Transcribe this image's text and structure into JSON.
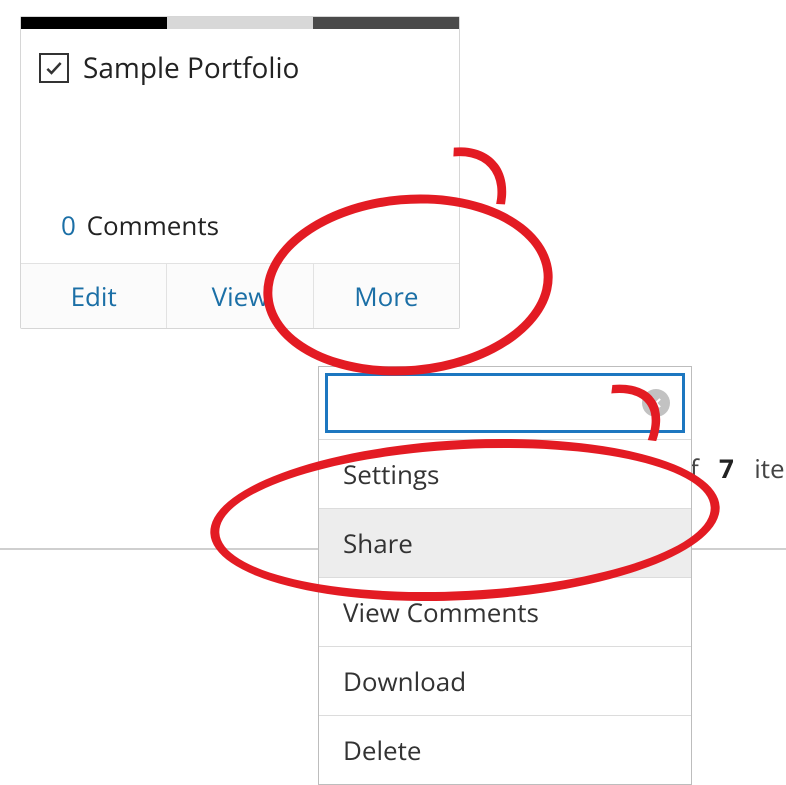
{
  "card": {
    "title": "Sample Portfolio",
    "comments_count": "0",
    "comments_label": "Comments",
    "actions": {
      "edit": "Edit",
      "view": "View",
      "more": "More"
    }
  },
  "pager": {
    "prefix_fragment": "f",
    "total": "7",
    "suffix": "items"
  },
  "menu": {
    "search_value": "",
    "items": {
      "settings": "Settings",
      "share": "Share",
      "view_comments": "View Comments",
      "download": "Download",
      "delete": "Delete"
    }
  }
}
